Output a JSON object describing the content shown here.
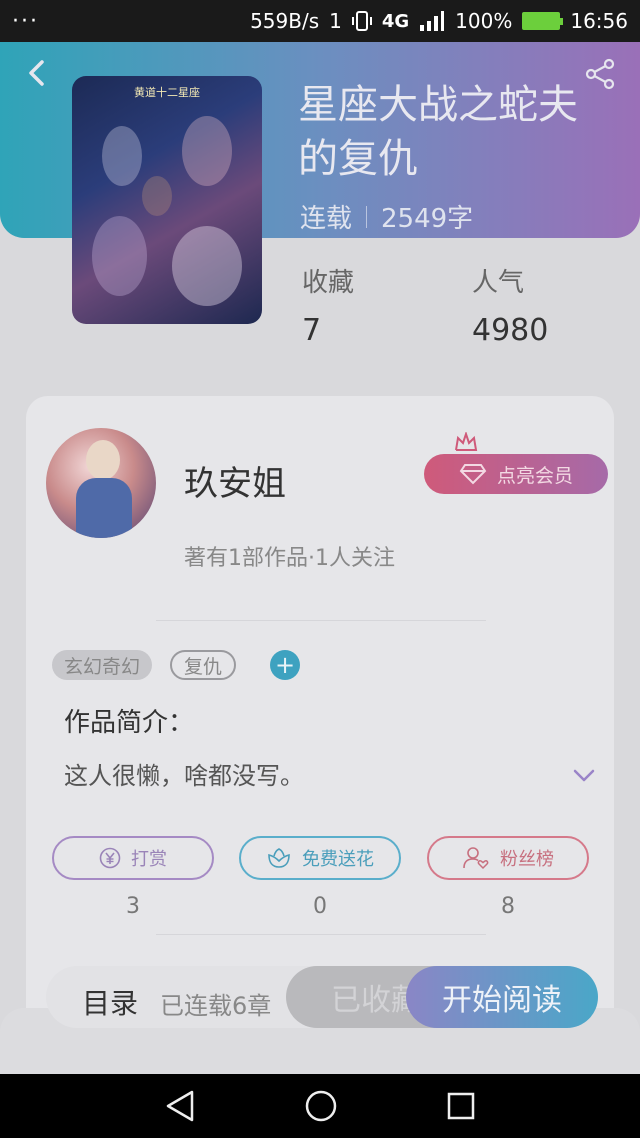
{
  "status_bar": {
    "dots": "···",
    "network_speed": "559B/s",
    "sim_indicator": "1",
    "network_type": "4G",
    "battery_percent": "100%",
    "time": "16:56"
  },
  "book": {
    "title": "星座大战之蛇夫的复仇",
    "status": "连载",
    "word_count": "2549字",
    "cover_caption": "黄道十二星座"
  },
  "stats": {
    "favorites_label": "收藏",
    "favorites_value": "7",
    "popularity_label": "人气",
    "popularity_value": "4980"
  },
  "author": {
    "name": "玖安姐",
    "subtitle": "著有1部作品·1人关注",
    "vip_button": "点亮会员"
  },
  "tags": [
    "玄幻奇幻",
    "复仇"
  ],
  "add_tag": "+",
  "intro": {
    "heading": "作品简介：",
    "text": "这人很懒，啥都没写。"
  },
  "actions": [
    {
      "label": "打赏",
      "count": "3",
      "icon": "yen-coin-icon"
    },
    {
      "label": "免费送花",
      "count": "0",
      "icon": "flower-icon"
    },
    {
      "label": "粉丝榜",
      "count": "8",
      "icon": "user-heart-icon"
    }
  ],
  "bottom": {
    "toc_label": "目录",
    "toc_count": "已连载6章",
    "favorited_button": "已收藏",
    "read_button": "开始阅读"
  },
  "colors": {
    "header_start": "#2fa4b8",
    "header_end": "#9a70b8",
    "read_start": "#8a86c6",
    "read_end": "#4aa7c8",
    "vip_start": "#cf5a7a",
    "vip_end": "#a66aa8"
  }
}
